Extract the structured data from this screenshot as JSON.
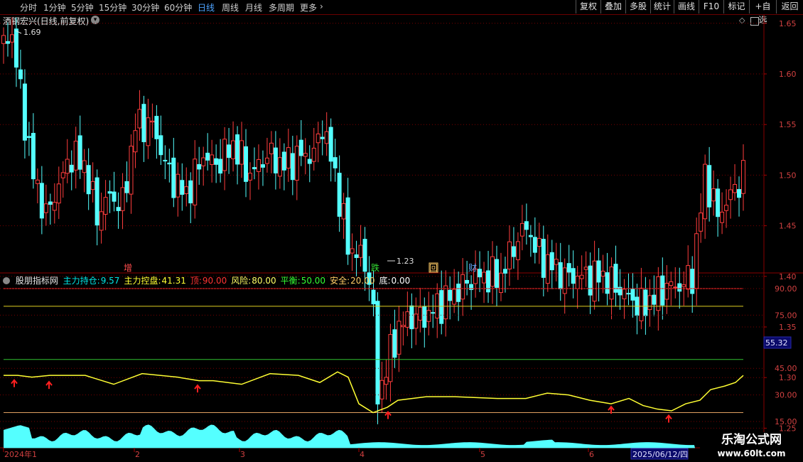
{
  "toolbar": {
    "periods": [
      "分时",
      "1分钟",
      "5分钟",
      "15分钟",
      "30分钟",
      "60分钟",
      "日线",
      "周线",
      "月线",
      "多周期",
      "更多"
    ],
    "active_period": "日线",
    "more_arrow": "›",
    "buttons": [
      "复权",
      "叠加",
      "多股",
      "统计",
      "画线",
      "F10",
      "标记",
      "+自选",
      "返回"
    ]
  },
  "main_chart": {
    "title": "酒钢宏兴(日线,前复权)",
    "dropdown_icon": "chevron-down-icon",
    "price_axis": [
      "1.65",
      "1.60",
      "1.55",
      "1.50",
      "1.45",
      "1.40",
      "1.35",
      "1.30",
      "1.25"
    ],
    "high_label": "1.69",
    "low_label": "1.23",
    "event_markers": [
      {
        "text": "增",
        "color": "#ff4d4d"
      },
      {
        "text": "跌",
        "color": "#33dd33"
      },
      {
        "text": "回",
        "color": "#ffcc66"
      },
      {
        "text": "财",
        "color": "#66aaff"
      }
    ]
  },
  "indicator": {
    "name": "股朋指标网",
    "items": [
      {
        "label": "主力持仓:",
        "value": "9.57",
        "color": "#00e5e5"
      },
      {
        "label": "主力控盘:",
        "value": "41.31",
        "color": "#ffff33"
      },
      {
        "label": "顶:",
        "value": "90.00",
        "color": "#ff3333"
      },
      {
        "label": "风险:",
        "value": "80.00",
        "color": "#ffff66"
      },
      {
        "label": "平衡:",
        "value": "50.00",
        "color": "#33ff33"
      },
      {
        "label": "安全:",
        "value": "20.00",
        "color": "#ffcc66"
      },
      {
        "label": "底:",
        "value": "0.00",
        "color": "#ffffff"
      }
    ],
    "axis": [
      "90.00",
      "75.00",
      "45.00",
      "30.00",
      "15.00"
    ],
    "current_value": "55.32"
  },
  "time_axis": {
    "labels": [
      "2024年1",
      "2",
      "3",
      "4",
      "5",
      "6"
    ],
    "cursor_date": "2025/06/12/四"
  },
  "watermark": {
    "title": "乐淘公式网",
    "url": "www.60lt.com"
  },
  "colors": {
    "up": "#ff3d3d",
    "down": "#54ffff",
    "grid": "#7a0000"
  }
}
